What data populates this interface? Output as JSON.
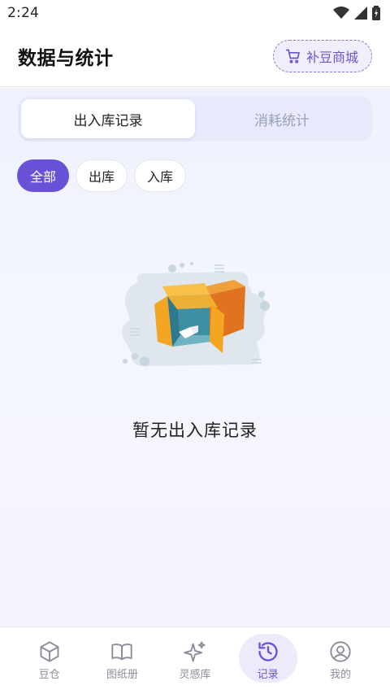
{
  "status_bar": {
    "time": "2:24"
  },
  "header": {
    "title": "数据与统计",
    "shop_button": "补豆商城"
  },
  "segments": [
    {
      "label": "出入库记录",
      "active": true
    },
    {
      "label": "消耗统计",
      "active": false
    }
  ],
  "filters": [
    {
      "label": "全部",
      "active": true
    },
    {
      "label": "出库",
      "active": false
    },
    {
      "label": "入库",
      "active": false
    }
  ],
  "empty_state": {
    "message": "暂无出入库记录"
  },
  "bottom_nav": [
    {
      "label": "豆仓",
      "icon": "cube-icon",
      "active": false
    },
    {
      "label": "图纸册",
      "icon": "book-icon",
      "active": false
    },
    {
      "label": "灵感库",
      "icon": "sparkle-icon",
      "active": false
    },
    {
      "label": "记录",
      "icon": "history-icon",
      "active": true
    },
    {
      "label": "我的",
      "icon": "user-icon",
      "active": false
    }
  ],
  "colors": {
    "accent": "#6a52d8",
    "accent_light": "#eeeafc"
  }
}
